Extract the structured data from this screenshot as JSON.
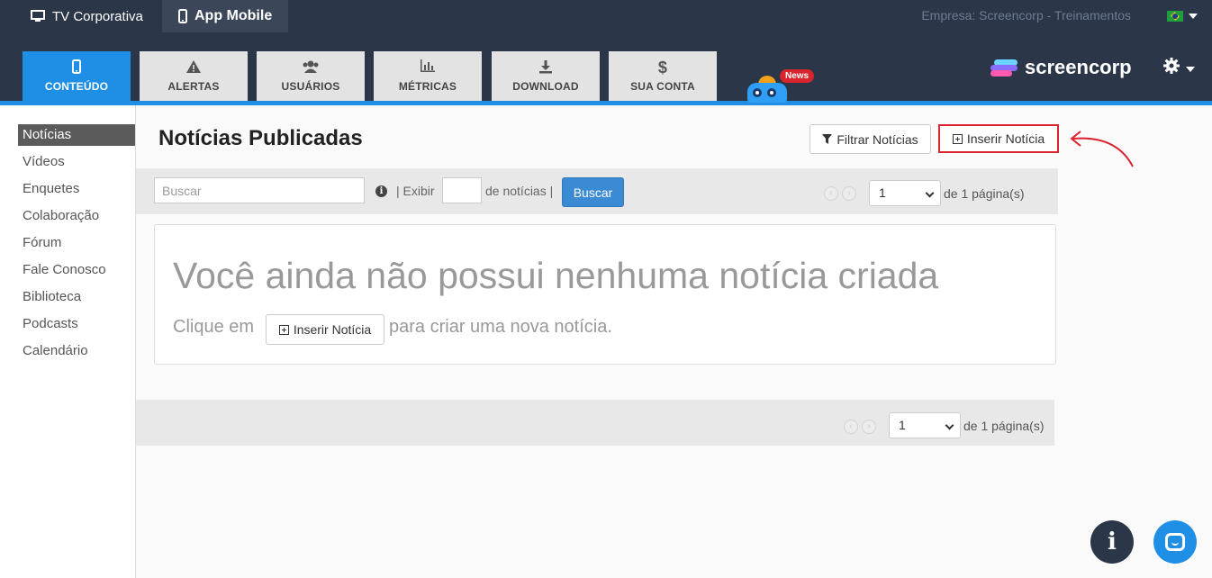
{
  "top": {
    "tabs": [
      {
        "label": "TV Corporativa",
        "icon": "monitor-icon"
      },
      {
        "label": "App Mobile",
        "icon": "mobile-icon"
      }
    ],
    "company": "Empresa: Screencorp - Treinamentos",
    "language_flag": "brazil-flag-icon"
  },
  "nav": {
    "tabs": [
      {
        "label": "CONTEÚDO",
        "icon": "mobile-icon",
        "active": true
      },
      {
        "label": "ALERTAS",
        "icon": "warning-icon"
      },
      {
        "label": "USUÁRIOS",
        "icon": "users-icon"
      },
      {
        "label": "MÉTRICAS",
        "icon": "bar-chart-icon"
      },
      {
        "label": "DOWNLOAD",
        "icon": "download-icon"
      },
      {
        "label": "SUA CONTA",
        "icon": "dollar-icon"
      }
    ],
    "news_badge": "News",
    "logo_text": "screencorp",
    "accent": "#1f8fe6",
    "header_bg": "#2b3648"
  },
  "sidebar": {
    "items": [
      {
        "label": "Notícias",
        "active": true
      },
      {
        "label": "Vídeos"
      },
      {
        "label": "Enquetes"
      },
      {
        "label": "Colaboração"
      },
      {
        "label": "Fórum"
      },
      {
        "label": "Fale Conosco"
      },
      {
        "label": "Biblioteca"
      },
      {
        "label": "Podcasts"
      },
      {
        "label": "Calendário"
      }
    ]
  },
  "main": {
    "title": "Notícias Publicadas",
    "filter_button": "Filtrar Notícias",
    "insert_button": "Inserir Notícia",
    "toolbar": {
      "search_placeholder": "Buscar",
      "exibir_label": "| Exibir",
      "de_noticias_label": "de notícias |",
      "search_button": "Buscar",
      "page_value": "1",
      "page_suffix": "de 1 página(s)"
    },
    "empty": {
      "heading": "Você ainda não possui nenhuma notícia criada",
      "line_prefix": "Clique em",
      "line_button": "Inserir Notícia",
      "line_suffix": "para criar uma nova notícia."
    },
    "bottom_pager": {
      "page_value": "1",
      "page_suffix": "de 1 página(s)"
    }
  }
}
